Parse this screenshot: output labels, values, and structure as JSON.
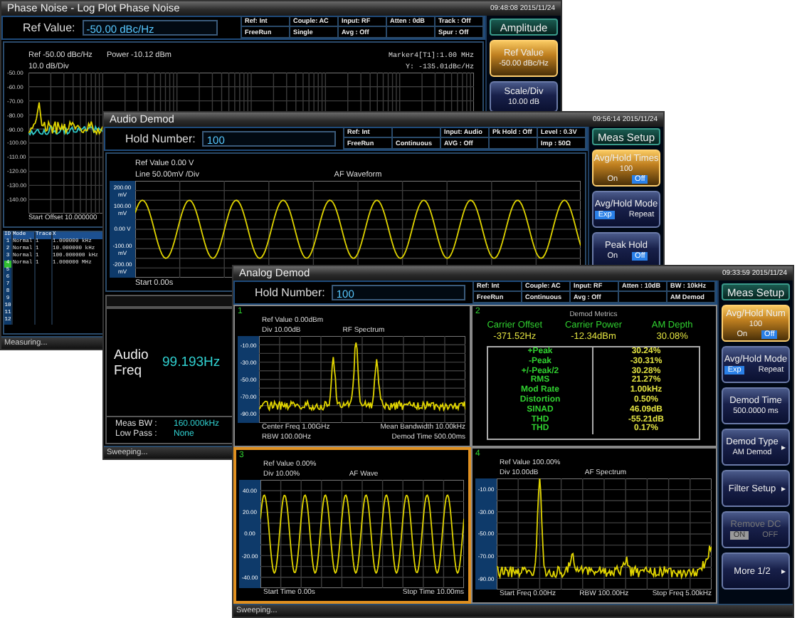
{
  "windows": [
    {
      "kind": "phase_noise",
      "title": "Phase Noise - Log Plot Phase Noise",
      "time": "09:48:08 2015/11/24",
      "field": {
        "label": "Ref Value:",
        "value": "-50.00 dBc/Hz"
      },
      "status": [
        {
          "top": "Ref: Int",
          "bottom": "FreeRun"
        },
        {
          "top": "Couple: AC",
          "bottom": "Single"
        },
        {
          "top": "Input: RF",
          "bottom": "Avg : Off"
        },
        {
          "top": "Atten : 0dB"
        },
        {
          "top": "Track : Off",
          "bottom": "Spur : Off"
        }
      ],
      "chart": {
        "ref": "Ref -50.00 dBc/Hz",
        "power": "Power -10.12 dBm",
        "scale": "10.0 dB/Div",
        "marker": "Marker4[T1]:1.00 MHz",
        "marker_y": "Y: -135.01dBc/Hz",
        "y_labels": [
          "-50.00",
          "-60.00",
          "-70.00",
          "-80.00",
          "-90.00",
          "-100.00",
          "-110.00",
          "-120.00",
          "-130.00",
          "-140.00"
        ],
        "start": "Start Offset 10.000000"
      },
      "marker_table": {
        "columns": [
          "ID",
          "Mode",
          "Trace",
          "X"
        ],
        "rows": [
          {
            "cells": [
              "1",
              "Normal",
              "1",
              "1.000000 kHz"
            ],
            "selected": false
          },
          {
            "cells": [
              "2",
              "Normal",
              "1",
              "10.000000 kHz"
            ],
            "selected": false
          },
          {
            "cells": [
              "3",
              "Normal",
              "1",
              "100.000000 kHz"
            ],
            "selected": false
          },
          {
            "cells": [
              "4",
              "Normal",
              "1",
              "1.000000 MHz"
            ],
            "selected": true
          },
          {
            "cells": [
              "5"
            ],
            "selected": false
          },
          {
            "cells": [
              "6"
            ],
            "selected": false
          },
          {
            "cells": [
              "7"
            ],
            "selected": false
          },
          {
            "cells": [
              "8"
            ],
            "selected": false
          },
          {
            "cells": [
              "9"
            ],
            "selected": false
          },
          {
            "cells": [
              "10"
            ],
            "selected": false
          },
          {
            "cells": [
              "11"
            ],
            "selected": false
          },
          {
            "cells": [
              "12"
            ],
            "selected": false
          }
        ]
      },
      "status_bar": "Measuring...",
      "softkeys": [
        {
          "kind": "header",
          "label": "Amplitude",
          "selected": false
        },
        {
          "kind": "value",
          "label": "Ref Value",
          "value": "-50.00 dBc/Hz",
          "selected": true
        },
        {
          "kind": "value",
          "label": "Scale/Div",
          "value": "10.00 dB",
          "selected": false
        }
      ]
    },
    {
      "kind": "audio_demod",
      "title": "Audio Demod",
      "time": "09:56:14 2015/11/24",
      "field": {
        "label": "Hold Number:",
        "value": "100"
      },
      "status": [
        {
          "top": "Ref: Int",
          "bottom": "FreeRun"
        },
        {
          "bottom": "Continuous"
        },
        {
          "top": "Input: Audio",
          "bottom": "AVG : Off"
        },
        {
          "top": "Pk Hold : Off"
        },
        {
          "top": "Level : 0.3V",
          "bottom": "Imp : 50Ω"
        }
      ],
      "chart": {
        "ref": "Ref Value 0.00 V",
        "scale": "Line 50.00mV /Div",
        "title": "AF Waveform",
        "y_labels": [
          "200.00 mV",
          "100.00 mV",
          "0.00 V",
          "-100.00 mV",
          "-200.00 mV"
        ],
        "start": "Start 0.00s"
      },
      "readout": {
        "label": "Audio Freq",
        "value": "99.193Hz",
        "rows": [
          {
            "label": "Meas BW :",
            "value": "160.000kHz"
          },
          {
            "label": "Low Pass :",
            "value": "None"
          }
        ]
      },
      "status_bar": "Sweeping...",
      "softkeys": [
        {
          "kind": "header",
          "label": "Meas Setup",
          "selected": false
        },
        {
          "kind": "toggle",
          "label": "Avg/Hold Times",
          "value": "100",
          "options": [
            {
              "label": "On",
              "selected": false
            },
            {
              "label": "Off",
              "selected": true
            }
          ],
          "selected": true
        },
        {
          "kind": "toggle",
          "label": "Avg/Hold Mode",
          "options": [
            {
              "label": "Exp",
              "selected": true
            },
            {
              "label": "Repeat",
              "selected": false
            }
          ],
          "selected": false
        },
        {
          "kind": "toggle",
          "label": "Peak Hold",
          "options": [
            {
              "label": "On",
              "selected": false
            },
            {
              "label": "Off",
              "selected": true
            }
          ],
          "selected": false
        }
      ]
    },
    {
      "kind": "analog_demod",
      "title": "Analog Demod",
      "time": "09:33:59 2015/11/24",
      "field": {
        "label": "Hold Number:",
        "value": "100"
      },
      "status": [
        {
          "top": "Ref: Int",
          "bottom": "FreeRun"
        },
        {
          "top": "Couple: AC",
          "bottom": "Continuous"
        },
        {
          "top": "Input: RF",
          "bottom": "Avg : Off"
        },
        {
          "top": "Atten : 10dB"
        },
        {
          "top": "BW : 10kHz",
          "bottom": "AM Demod"
        }
      ],
      "panels": [
        {
          "kind": "rf_spectrum",
          "number": "1",
          "selected": false,
          "ref": "Ref Value 0.00dBm",
          "scale": "Div 10.00dB",
          "title": "RF Spectrum",
          "y_labels": [
            "-10.00",
            "-30.00",
            "-50.00",
            "-70.00",
            "-90.00"
          ],
          "footer": [
            [
              "Center Freq 1.00GHz",
              "Mean Bandwidth 10.00kHz"
            ],
            [
              "RBW 100.00Hz",
              "Demod Time 500.00ms"
            ]
          ]
        },
        {
          "kind": "metrics",
          "number": "2",
          "selected": false,
          "title": "Demod Metrics",
          "summary": [
            {
              "label": "Carrier Offset",
              "value": "-371.52Hz"
            },
            {
              "label": "Carrier Power",
              "value": "-12.34dBm"
            },
            {
              "label": "AM Depth",
              "value": "30.08%"
            }
          ],
          "rows": [
            {
              "label": "+Peak",
              "value": "30.24%"
            },
            {
              "label": "-Peak",
              "value": "-30.31%"
            },
            {
              "label": "+/-Peak/2",
              "value": "30.28%"
            },
            {
              "label": "RMS",
              "value": "21.27%"
            },
            {
              "label": "Mod Rate",
              "value": "1.00kHz"
            },
            {
              "label": "Distortion",
              "value": "0.50%"
            },
            {
              "label": "SINAD",
              "value": "46.09dB"
            },
            {
              "label": "THD",
              "value": "-55.21dB"
            },
            {
              "label": "THD",
              "value": "0.17%"
            }
          ]
        },
        {
          "kind": "af_wave",
          "number": "3",
          "selected": true,
          "ref": "Ref Value 0.00%",
          "scale": "Div 10.00%",
          "title": "AF Wave",
          "y_labels": [
            "40.00",
            "20.00",
            "0.00",
            "-20.00",
            "-40.00"
          ],
          "footer": [
            [
              "Start Time 0.00s",
              "Stop Time 10.00ms"
            ]
          ]
        },
        {
          "kind": "af_spectrum",
          "number": "4",
          "selected": false,
          "ref": "Ref Value 100.00%",
          "scale": "Div 10.00dB",
          "title": "AF Spectrum",
          "y_labels": [
            "-10.00",
            "-30.00",
            "-50.00",
            "-70.00",
            "-90.00"
          ],
          "footer": [
            [
              "Start Freq 0.00Hz",
              "RBW 100.00Hz",
              "Stop Freq 5.00kHz"
            ]
          ]
        }
      ],
      "status_bar": "Sweeping...",
      "softkeys": [
        {
          "kind": "header",
          "label": "Meas Setup",
          "selected": false,
          "disabled": false
        },
        {
          "kind": "toggle",
          "label": "Avg/Hold Num",
          "value": "100",
          "options": [
            {
              "label": "On",
              "selected": false
            },
            {
              "label": "Off",
              "selected": true
            }
          ],
          "selected": true,
          "disabled": false
        },
        {
          "kind": "toggle",
          "label": "Avg/Hold Mode",
          "options": [
            {
              "label": "Exp",
              "selected": true
            },
            {
              "label": "Repeat",
              "selected": false
            }
          ],
          "selected": false,
          "disabled": false
        },
        {
          "kind": "value",
          "label": "Demod Time",
          "value": "500.0000 ms",
          "selected": false,
          "disabled": false
        },
        {
          "kind": "submenu",
          "label": "Demod Type",
          "value": "AM Demod",
          "arrow": "▸",
          "selected": false,
          "disabled": false
        },
        {
          "kind": "submenu",
          "label": "Filter Setup",
          "arrow": "▸",
          "selected": false,
          "disabled": false
        },
        {
          "kind": "toggle",
          "label": "Remove DC",
          "options": [
            {
              "label": "ON",
              "selected": true
            },
            {
              "label": "OFF",
              "selected": false
            }
          ],
          "selected": false,
          "disabled": true
        },
        {
          "kind": "submenu",
          "label": "More 1/2",
          "arrow": "▸",
          "selected": false,
          "disabled": false
        }
      ]
    }
  ]
}
